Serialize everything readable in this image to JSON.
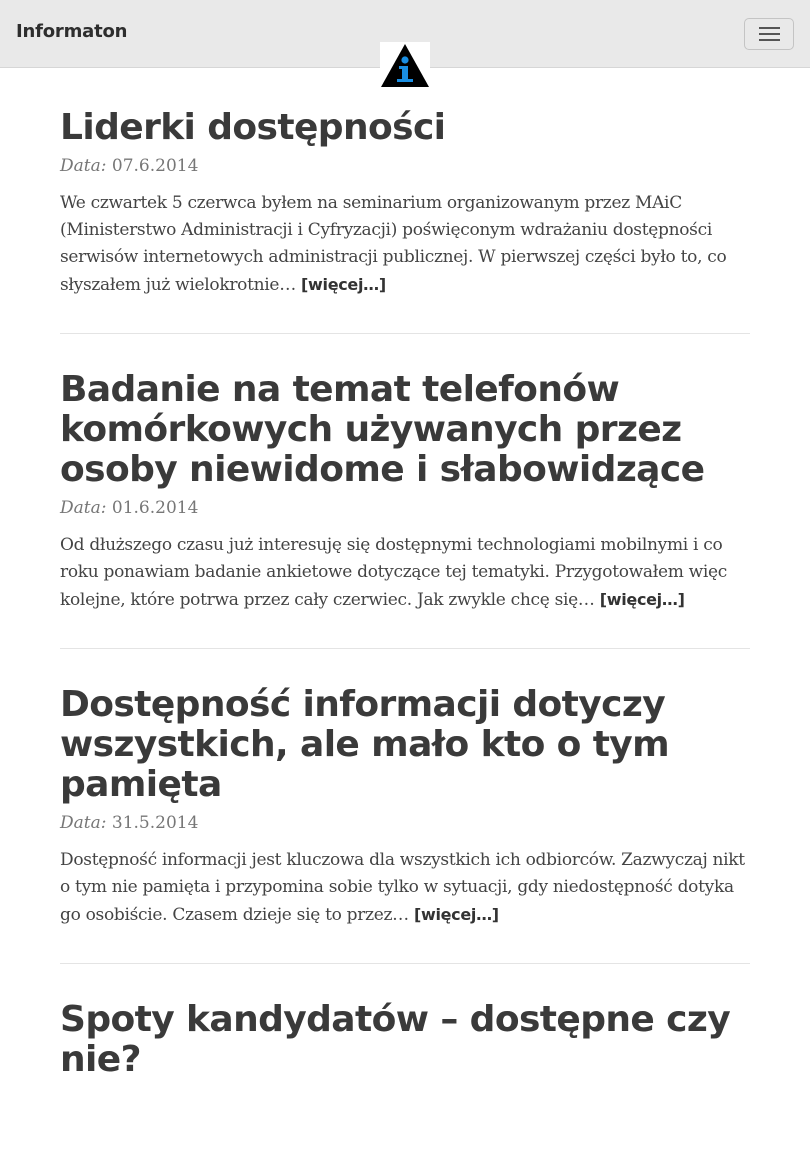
{
  "navbar": {
    "brand": "Informaton",
    "logo_icon": "information-i-triangle",
    "menu_icon": "hamburger-menu",
    "accent": "#1a8fe3"
  },
  "posts": [
    {
      "title": "Liderki dostępności",
      "date_label": "Data:",
      "date": "07.6.2014",
      "excerpt": "We czwartek 5 czerwca byłem na seminarium organizowanym przez MAiC (Ministerstwo Administracji i Cyfryzacji) poświęconym wdrażaniu dostępności serwisów internetowych administracji publicznej. W pierwszej części było to, co słyszałem już wielokrotnie…",
      "more": "[więcej…]"
    },
    {
      "title": "Badanie na temat telefonów komórkowych używanych przez osoby niewidome i słabowidzące",
      "date_label": "Data:",
      "date": "01.6.2014",
      "excerpt": "Od dłuższego czasu już interesuję się dostępnymi technologiami mobilnymi i co roku ponawiam badanie ankietowe dotyczące tej tematyki. Przygotowałem więc kolejne, które potrwa przez cały czerwiec. Jak zwykle chcę się…",
      "more": "[więcej…]"
    },
    {
      "title": "Dostępność informacji dotyczy wszystkich, ale mało kto o tym pamięta",
      "date_label": "Data:",
      "date": "31.5.2014",
      "excerpt": "Dostępność informacji jest kluczowa dla wszystkich ich odbiorców. Zazwyczaj nikt o tym nie pamięta i przypomina sobie tylko w sytuacji, gdy niedostępność dotyka go osobiście. Czasem dzieje się to przez…",
      "more": "[więcej…]"
    },
    {
      "title": "Spoty kandydatów – dostępne czy nie?"
    }
  ]
}
